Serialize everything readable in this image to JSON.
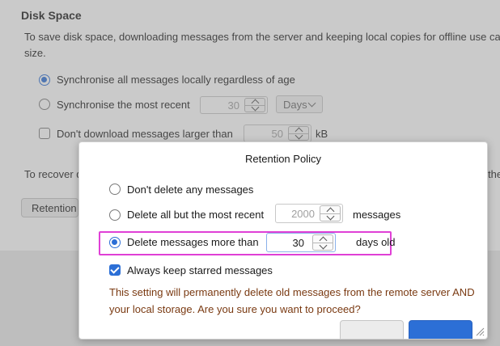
{
  "disk_space": {
    "title": "Disk Space",
    "description_line1": "To save disk space, downloading messages from the server and keeping local copies for offline use can",
    "description_line2": "size.",
    "sync_all_label": "Synchronise all messages locally regardless of age",
    "sync_recent_label": "Synchronise the most recent",
    "sync_recent_value": "30",
    "sync_recent_unit": "Days",
    "dont_download_label": "Don't download messages larger than",
    "dont_download_value": "50",
    "dont_download_unit": "kB",
    "recover_text": "To recover d",
    "recover_text_right": "the",
    "retention_button": "Retention"
  },
  "dialog": {
    "title": "Retention Policy",
    "option_none": "Don't delete any messages",
    "option_recent": "Delete all but the most recent",
    "option_recent_value": "2000",
    "option_recent_unit": "messages",
    "option_older": "Delete messages more than",
    "option_older_value": "30",
    "option_older_unit": "days old",
    "keep_starred": "Always keep starred messages",
    "warning_line1": "This setting will permanently delete old messages from the remote server AND",
    "warning_line2": "your local storage. Are you sure you want to proceed?"
  },
  "colors": {
    "accent": "#2c6fd6",
    "highlight": "#e040d6",
    "warning": "#7a3a12"
  }
}
